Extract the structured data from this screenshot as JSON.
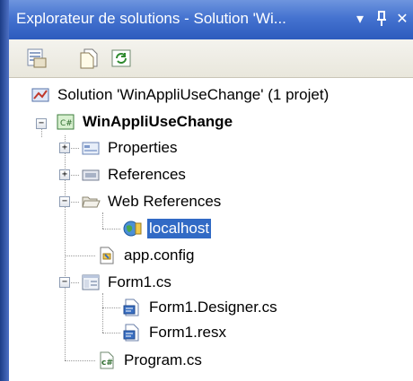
{
  "window": {
    "title": "Explorateur de solutions - Solution 'Wi...",
    "dropdown_glyph": "▾",
    "pin_glyph": "⊥",
    "close_glyph": "✕"
  },
  "toolbar": {
    "buttons": [
      "properties-icon",
      "show-all-files-icon",
      "refresh-icon"
    ]
  },
  "tree": {
    "solution": "Solution 'WinAppliUseChange' (1 projet)",
    "project": "WinAppliUseChange",
    "properties": "Properties",
    "references": "References",
    "web_references": "Web References",
    "localhost": "localhost",
    "app_config": "app.config",
    "form1": "Form1.cs",
    "form1_designer": "Form1.Designer.cs",
    "form1_resx": "Form1.resx",
    "program": "Program.cs"
  },
  "colors": {
    "titlebar": "#4573d0",
    "selection": "#316ac5"
  }
}
